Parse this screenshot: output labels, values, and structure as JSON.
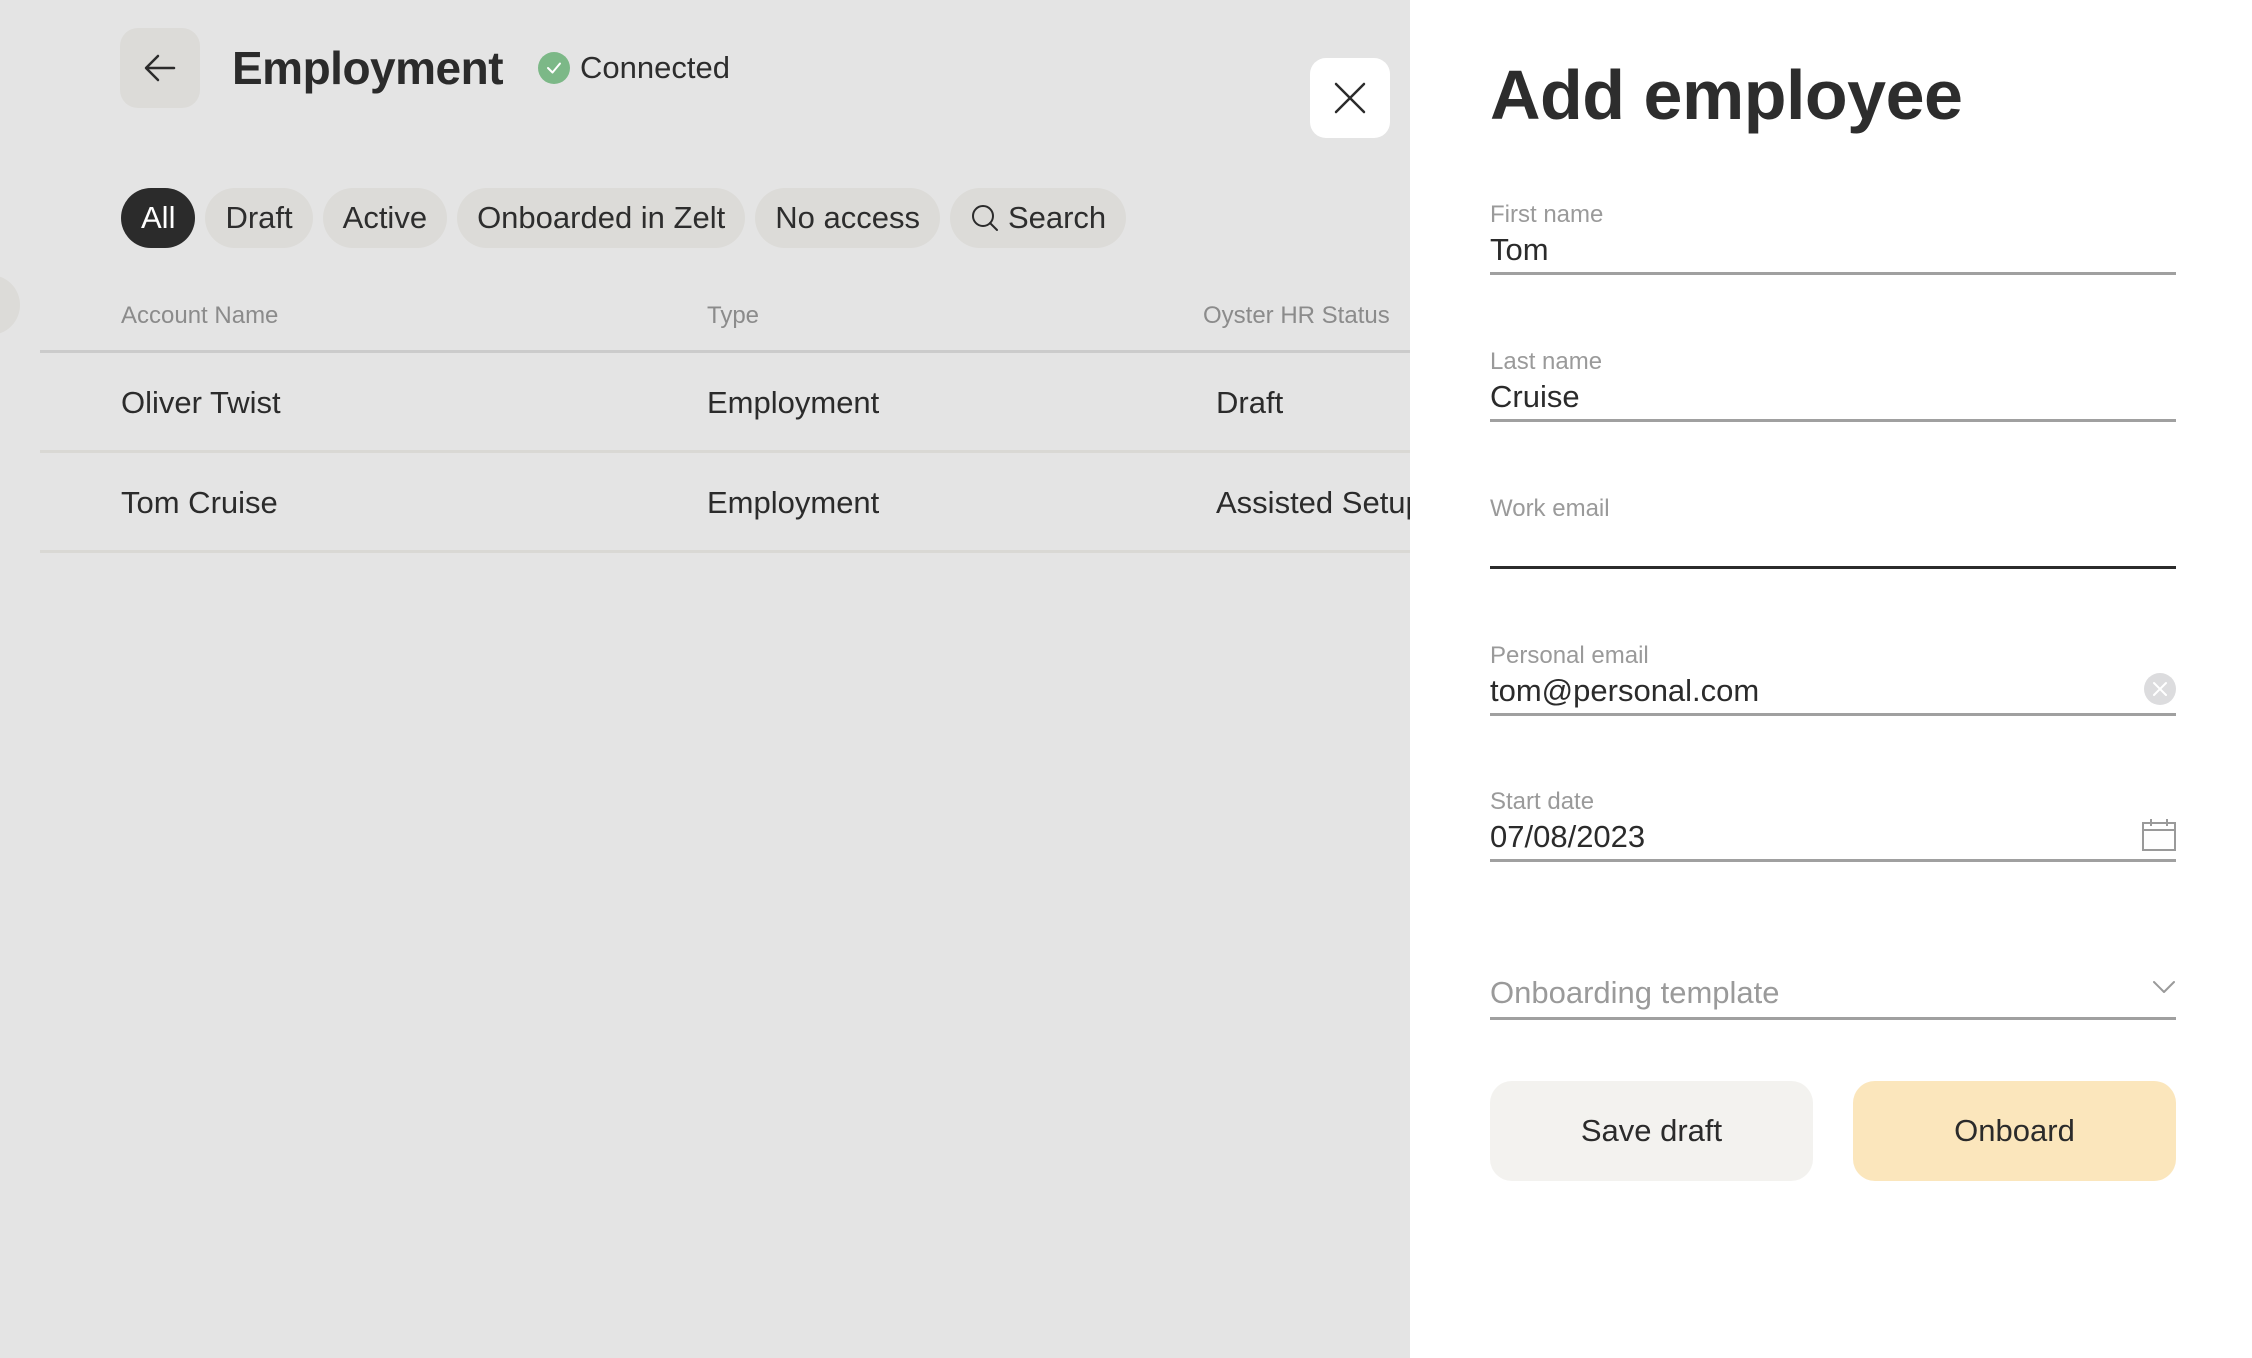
{
  "header": {
    "back_icon": "arrow-left-icon",
    "title": "Employment",
    "status_icon": "check-circle-icon",
    "status_text": "Connected",
    "status_color": "#7cb887"
  },
  "filters": [
    {
      "label": "All",
      "active": true
    },
    {
      "label": "Draft",
      "active": false
    },
    {
      "label": "Active",
      "active": false
    },
    {
      "label": "Onboarded in Zelt",
      "active": false
    },
    {
      "label": "No access",
      "active": false
    },
    {
      "label": "Search",
      "icon": "search-icon",
      "active": false
    }
  ],
  "table": {
    "columns": [
      "Account Name",
      "Type",
      "Oyster HR Status"
    ],
    "rows": [
      [
        "Oliver Twist",
        "Employment",
        "Draft"
      ],
      [
        "Tom Cruise",
        "Employment",
        "Assisted Setup"
      ]
    ]
  },
  "panel": {
    "close_icon": "close-icon",
    "title": "Add employee",
    "fields": {
      "first_name": {
        "label": "First name",
        "value": "Tom"
      },
      "last_name": {
        "label": "Last name",
        "value": "Cruise"
      },
      "work_email": {
        "label": "Work email",
        "value": ""
      },
      "personal_email": {
        "label": "Personal email",
        "value": "tom@personal.com",
        "icon": "clear-icon"
      },
      "start_date": {
        "label": "Start date",
        "value": "07/08/2023",
        "icon": "calendar-icon"
      },
      "onboarding_template": {
        "placeholder": "Onboarding template",
        "icon": "chevron-down-icon"
      }
    },
    "buttons": {
      "save_draft": "Save draft",
      "onboard": "Onboard"
    },
    "colors": {
      "onboard_bg": "#fbe6bc",
      "save_bg": "#f3f2ef"
    }
  }
}
